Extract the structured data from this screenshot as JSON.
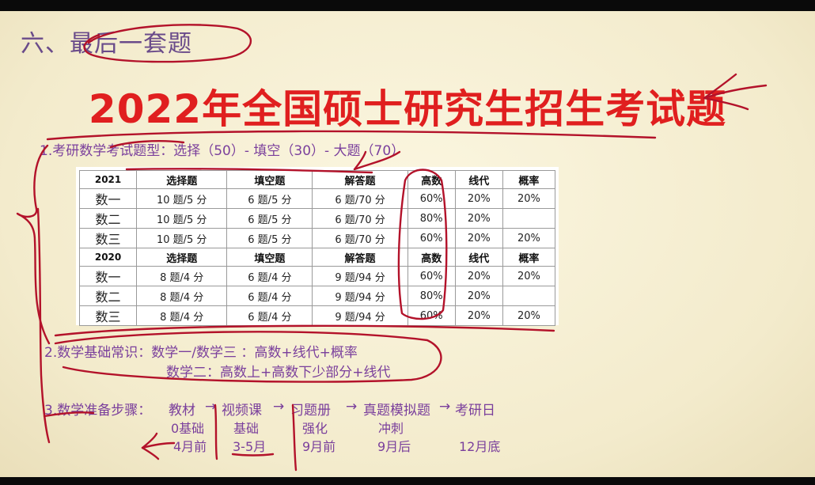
{
  "slide": {
    "section_title": "六、最后一套题",
    "main_title": "2022年全国硕士研究生招生考试题",
    "point1": "1.考研数学考试题型：选择（50）- 填空（30）- 大题（70）",
    "point2_line1": "2.数学基础常识：数学一/数学三 ：高数+线代+概率",
    "point2_line2": "数学二：高数上+高数下少部分+线代",
    "point3_label": "3.数学准备步骤：",
    "steps": [
      "教材",
      "→",
      "视频课",
      "→",
      "习题册",
      "→",
      "真题模拟题",
      "→",
      "考研日"
    ],
    "stages": [
      "0基础",
      "基础",
      "强化",
      "冲刺"
    ],
    "timeline": [
      "4月前",
      "3-5月",
      "9月前",
      "9月后",
      "12月底"
    ]
  },
  "table": {
    "header_2021": [
      "2021",
      "选择题",
      "填空题",
      "解答题",
      "高数",
      "线代",
      "概率"
    ],
    "rows_2021": [
      [
        "数一",
        "10 题/5 分",
        "6 题/5 分",
        "6 题/70 分",
        "60%",
        "20%",
        "20%"
      ],
      [
        "数二",
        "10 题/5 分",
        "6 题/5 分",
        "6 题/70 分",
        "80%",
        "20%",
        ""
      ],
      [
        "数三",
        "10 题/5 分",
        "6 题/5 分",
        "6 题/70 分",
        "60%",
        "20%",
        "20%"
      ]
    ],
    "header_2020": [
      "2020",
      "选择题",
      "填空题",
      "解答题",
      "高数",
      "线代",
      "概率"
    ],
    "rows_2020": [
      [
        "数一",
        "8 题/4 分",
        "6 题/4 分",
        "9 题/94 分",
        "60%",
        "20%",
        "20%"
      ],
      [
        "数二",
        "8 题/4 分",
        "6 题/4 分",
        "9 题/94 分",
        "80%",
        "20%",
        ""
      ],
      [
        "数三",
        "8 题/4 分",
        "6 题/4 分",
        "9 题/94 分",
        "60%",
        "20%",
        "20%"
      ]
    ]
  },
  "colors": {
    "title_red": "#e01f1f",
    "text_purple": "#7a3f9c",
    "ink_red": "#b3122a",
    "slide_bg": "#f6efd6"
  }
}
